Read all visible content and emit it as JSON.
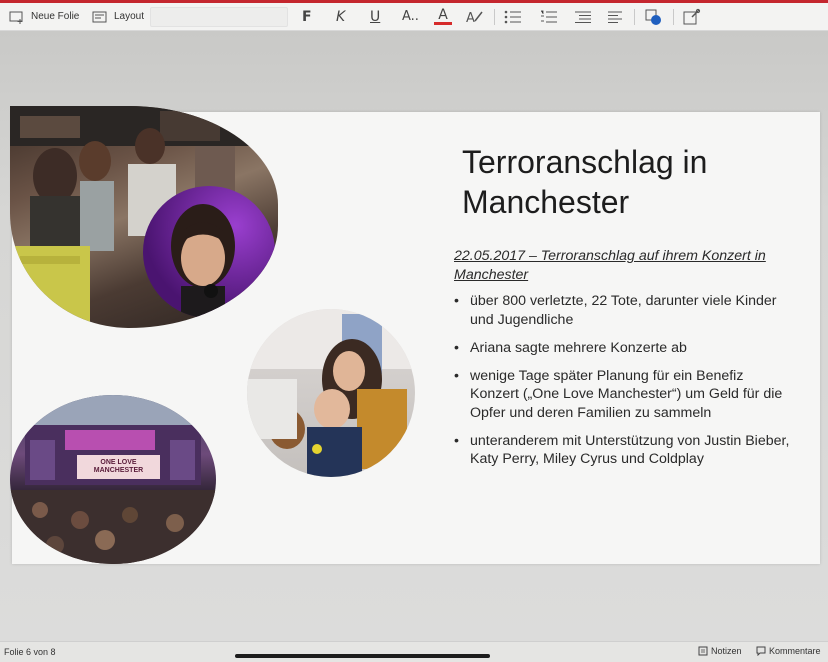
{
  "toolbar": {
    "new_slide_label": "Neue Folie",
    "layout_label": "Layout",
    "bold": "F",
    "italic": "K",
    "underline": "U",
    "text_size": "A..",
    "font_color": "A",
    "accent_red": "#d62b2b"
  },
  "slide": {
    "title": "Terroranschlag in Manchester",
    "subtitle": "22.05.2017 – Terroranschlag auf ihrem Konzert in Manchester",
    "bullets": [
      "über 800 verletzte, 22 Tote, darunter viele Kinder und Jugendliche",
      "Ariana sagte mehrere Konzerte ab",
      "wenige Tage später Planung für ein Benefiz Konzert („One Love Manchester“) um Geld für die Opfer und deren Familien zu sammeln",
      "unteranderem mit Unterstützung von Justin Bieber, Katy Perry, Miley Cyrus und Coldplay"
    ],
    "banner_text": "ONE LOVE MANCHESTER"
  },
  "status": {
    "slide_counter": "Folie 6 von 8",
    "notes_label": "Notizen",
    "comments_label": "Kommentare"
  }
}
